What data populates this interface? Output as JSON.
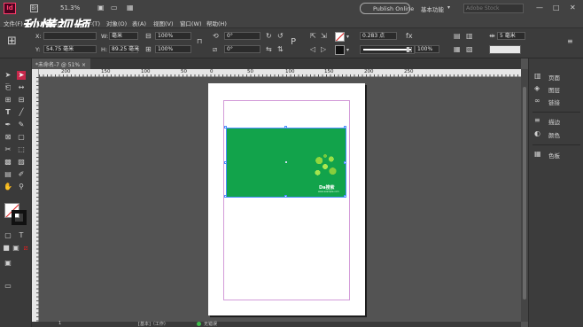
{
  "app": {
    "logo": "Id",
    "zoom": "51.3%",
    "publish_label": "Publish Online",
    "workspace": "基本功能",
    "search_placeholder": "Adobe Stock"
  },
  "watermark": "秒懂视频",
  "menu": [
    "文件(F)",
    "编辑(E)",
    "版面(L)",
    "文字(T)",
    "对象(O)",
    "表(A)",
    "视图(V)",
    "窗口(W)",
    "帮助(H)"
  ],
  "control": {
    "x_label": "X:",
    "x_value": "54.75 毫米",
    "y_label": "Y:",
    "y_value": "",
    "w_label": "W:",
    "w_value": "毫米",
    "h_label": "H:",
    "h_value": "89.25 毫米",
    "scale_x": "100%",
    "scale_y": "100%",
    "rotate": "0°",
    "shear": "0°",
    "stroke_weight": "0.283 点",
    "opacity": "100%",
    "gap": "5 毫米"
  },
  "document_tab": "*未命名-7 @ 51% ×",
  "ruler": {
    "top": [
      "200",
      "150",
      "100",
      "50",
      "0",
      "50",
      "100",
      "150",
      "200",
      "250"
    ]
  },
  "panels": [
    {
      "icon": "pages-icon",
      "label": "页面"
    },
    {
      "icon": "layers-icon",
      "label": "图层"
    },
    {
      "icon": "links-icon",
      "label": "链接"
    },
    {
      "icon": "stroke-icon",
      "label": "描边"
    },
    {
      "icon": "swatches-icon",
      "label": "颜色"
    },
    {
      "icon": "color-icon",
      "label": "色板"
    }
  ],
  "statusbar": {
    "page": "1",
    "style": "[基本]（工作）",
    "preflight": "无错误"
  },
  "artwork": {
    "brand": "Da搜索",
    "tagline": "www.example.com"
  },
  "colors": {
    "card_green": "#12a34b",
    "accent_pink": "#ff3d6a",
    "selection_blue": "#4a8eff"
  }
}
